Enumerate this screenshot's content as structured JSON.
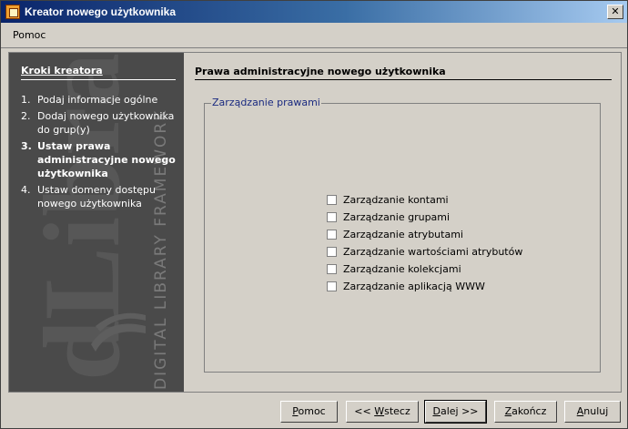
{
  "window": {
    "title": "Kreator nowego użytkownika",
    "close_label": "✕"
  },
  "menu": {
    "items": [
      "Pomoc"
    ]
  },
  "sidebar": {
    "title": "Kroki kreatora",
    "watermark_text": "DIGITAL LIBRARY FRAMEWORK",
    "steps": [
      {
        "num": "1.",
        "label": "Podaj informacje ogólne",
        "active": false
      },
      {
        "num": "2.",
        "label": "Dodaj nowego użytkownika do grup(y)",
        "active": false
      },
      {
        "num": "3.",
        "label": "Ustaw prawa administracyjne nowego użytkownika",
        "active": true
      },
      {
        "num": "4.",
        "label": "Ustaw domeny dostępu nowego użytkownika",
        "active": false
      }
    ]
  },
  "main": {
    "title": "Prawa administracyjne nowego użytkownika",
    "group_legend": "Zarządzanie prawami",
    "checkboxes": [
      {
        "label": "Zarządzanie kontami",
        "checked": false
      },
      {
        "label": "Zarządzanie grupami",
        "checked": false
      },
      {
        "label": "Zarządzanie atrybutami",
        "checked": false
      },
      {
        "label": "Zarządzanie wartościami atrybutów",
        "checked": false
      },
      {
        "label": "Zarządzanie kolekcjami",
        "checked": false
      },
      {
        "label": "Zarządzanie aplikacją WWW",
        "checked": false
      }
    ]
  },
  "buttons": {
    "help": {
      "pre": "",
      "ul": "P",
      "post": "omoc"
    },
    "back": {
      "pre": "<< ",
      "ul": "W",
      "post": "stecz"
    },
    "next": {
      "pre": "",
      "ul": "D",
      "post": "alej >>"
    },
    "finish": {
      "pre": "",
      "ul": "Z",
      "post": "akończ"
    },
    "cancel": {
      "pre": "",
      "ul": "A",
      "post": "nuluj"
    }
  },
  "colors": {
    "title_gradient_start": "#0a246a",
    "title_gradient_end": "#a6caf0",
    "sidebar_bg": "#4a4a4a",
    "legend_color": "#1a2a80"
  }
}
